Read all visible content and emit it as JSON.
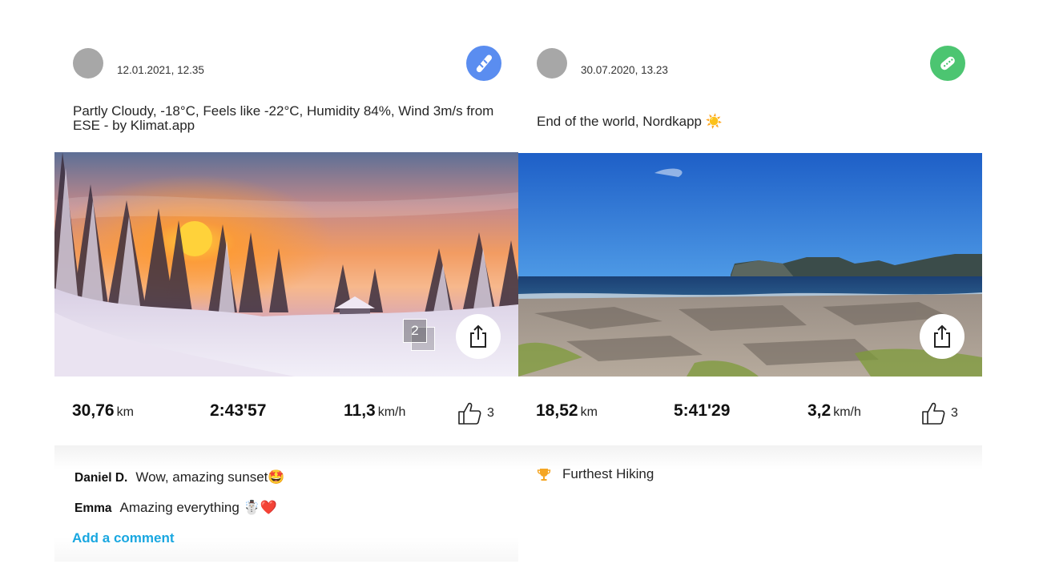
{
  "posts": [
    {
      "date": "12.01.2021, 12.35",
      "sport_icon": "snowboard-icon",
      "sport_color": "#5a8df0",
      "description": "Partly Cloudy, -18°C, Feels like -22°C, Humidity 84%, Wind 3m/s from ESE - by Klimat.app",
      "photo_count": "2",
      "stats": {
        "distance": "30,76",
        "distance_unit": "km",
        "duration": "2:43'57",
        "speed": "11,3",
        "speed_unit": "km/h"
      },
      "likes": "3",
      "comments": [
        {
          "author": "Daniel D.",
          "text": "Wow, amazing sunset🤩"
        },
        {
          "author": "Emma",
          "text": "Amazing everything ☃️❤️"
        }
      ],
      "add_comment": "Add a comment"
    },
    {
      "date": "30.07.2020, 13.23",
      "sport_icon": "hiking-shoe-icon",
      "sport_color": "#4cc571",
      "description": "End of the world, Nordkapp ☀️",
      "stats": {
        "distance": "18,52",
        "distance_unit": "km",
        "duration": "5:41'29",
        "speed": "3,2",
        "speed_unit": "km/h"
      },
      "likes": "3",
      "achievement": "Furthest Hiking",
      "achievement_icon": "trophy-icon",
      "achievement_color": "#f5a623"
    }
  ]
}
